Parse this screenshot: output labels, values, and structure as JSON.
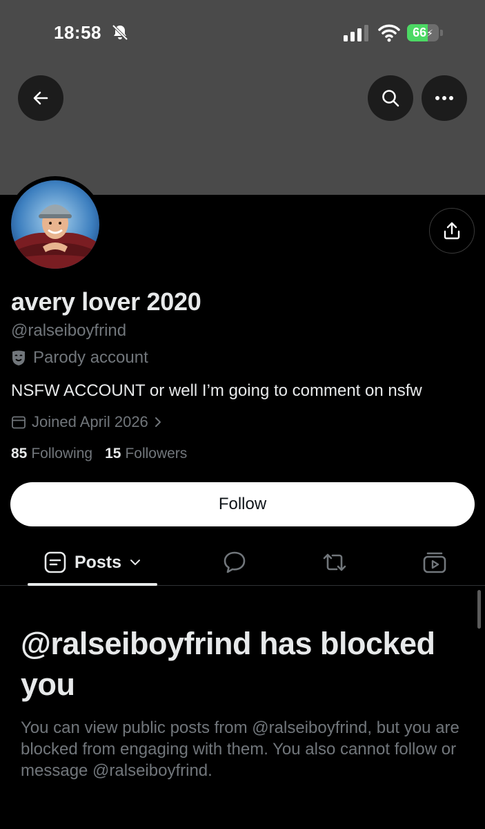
{
  "status_bar": {
    "time": "18:58",
    "battery": "66",
    "battery_level": 0.66,
    "battery_color": "#4cd964"
  },
  "header": {
    "back_icon": "arrow-left-icon",
    "search_icon": "search-icon",
    "more_icon": "more-horizontal-icon",
    "banner_color": "#4a4a4a"
  },
  "profile": {
    "display_name": "avery lover 2020",
    "handle": "@ralseiboyfrind",
    "parody_label": "Parody account",
    "bio": "NSFW ACCOUNT or well I’m going to comment on nsfw",
    "joined": "Joined April 2026",
    "following_count": "85",
    "following_label": "Following",
    "followers_count": "15",
    "followers_label": "Followers",
    "share_icon": "share-icon"
  },
  "actions": {
    "follow_label": "Follow"
  },
  "tabs": {
    "posts_label": "Posts",
    "posts_icon": "posts-icon",
    "replies_icon": "reply-bubble-icon",
    "reposts_icon": "repost-icon",
    "media_icon": "video-media-icon"
  },
  "blocked": {
    "title": "@ralseiboyfrind has blocked you",
    "description": "You can view public posts from @ralseiboyfrind, but you are blocked from engaging with them. You also cannot follow or message @ralseiboyfrind."
  }
}
